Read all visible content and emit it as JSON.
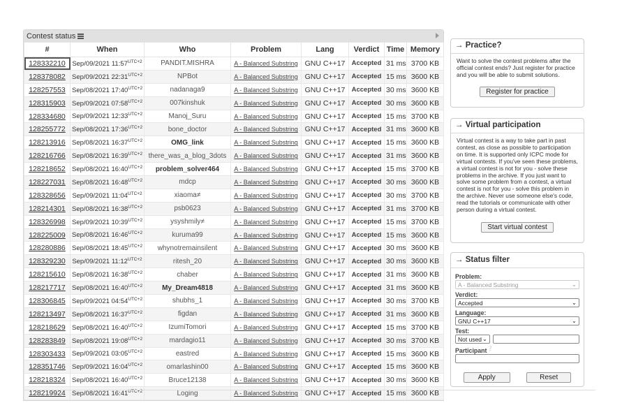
{
  "status": {
    "title": "Contest status",
    "columns": [
      "#",
      "When",
      "Who",
      "Problem",
      "Lang",
      "Verdict",
      "Time",
      "Memory"
    ],
    "rows": [
      {
        "id": "128332210",
        "when": "Sep/09/2021 11:57",
        "tz": "UTC+2",
        "who": "PANDIT.MISHRA",
        "who_bold": false,
        "problem": "A - Balanced Substring",
        "lang": "GNU C++17",
        "verdict": "Accepted",
        "time": "31 ms",
        "memory": "3700 KB"
      },
      {
        "id": "128378082",
        "when": "Sep/09/2021 22:31",
        "tz": "UTC+2",
        "who": "NPBot",
        "who_bold": false,
        "problem": "A - Balanced Substring",
        "lang": "GNU C++17",
        "verdict": "Accepted",
        "time": "15 ms",
        "memory": "3600 KB"
      },
      {
        "id": "128257553",
        "when": "Sep/08/2021 17:40",
        "tz": "UTC+2",
        "who": "nadanaga9",
        "who_bold": false,
        "problem": "A - Balanced Substring",
        "lang": "GNU C++17",
        "verdict": "Accepted",
        "time": "30 ms",
        "memory": "3600 KB"
      },
      {
        "id": "128315903",
        "when": "Sep/09/2021 07:58",
        "tz": "UTC+2",
        "who": "007kinshuk",
        "who_bold": false,
        "problem": "A - Balanced Substring",
        "lang": "GNU C++17",
        "verdict": "Accepted",
        "time": "30 ms",
        "memory": "3600 KB"
      },
      {
        "id": "128334680",
        "when": "Sep/09/2021 12:33",
        "tz": "UTC+2",
        "who": "Manoj_Suru",
        "who_bold": false,
        "problem": "A - Balanced Substring",
        "lang": "GNU C++17",
        "verdict": "Accepted",
        "time": "15 ms",
        "memory": "3700 KB"
      },
      {
        "id": "128255772",
        "when": "Sep/08/2021 17:36",
        "tz": "UTC+2",
        "who": "bone_doctor",
        "who_bold": false,
        "problem": "A - Balanced Substring",
        "lang": "GNU C++17",
        "verdict": "Accepted",
        "time": "31 ms",
        "memory": "3600 KB"
      },
      {
        "id": "128213916",
        "when": "Sep/08/2021 16:37",
        "tz": "UTC+2",
        "who": "OMG_link",
        "who_bold": true,
        "problem": "A - Balanced Substring",
        "lang": "GNU C++17",
        "verdict": "Accepted",
        "time": "15 ms",
        "memory": "3600 KB"
      },
      {
        "id": "128216766",
        "when": "Sep/08/2021 16:39",
        "tz": "UTC+2",
        "who": "there_was_a_blog_3dots",
        "who_bold": false,
        "problem": "A - Balanced Substring",
        "lang": "GNU C++17",
        "verdict": "Accepted",
        "time": "31 ms",
        "memory": "3600 KB"
      },
      {
        "id": "128218652",
        "when": "Sep/08/2021 16:40",
        "tz": "UTC+2",
        "who": "problem_solver464",
        "who_bold": true,
        "problem": "A - Balanced Substring",
        "lang": "GNU C++17",
        "verdict": "Accepted",
        "time": "15 ms",
        "memory": "3700 KB"
      },
      {
        "id": "128227031",
        "when": "Sep/08/2021 16:48",
        "tz": "UTC+2",
        "who": "mdcp",
        "who_bold": false,
        "problem": "A - Balanced Substring",
        "lang": "GNU C++17",
        "verdict": "Accepted",
        "time": "30 ms",
        "memory": "3600 KB"
      },
      {
        "id": "128328656",
        "when": "Sep/09/2021 11:04",
        "tz": "UTC+2",
        "who": "xiaoma≠",
        "who_bold": false,
        "problem": "A - Balanced Substring",
        "lang": "GNU C++17",
        "verdict": "Accepted",
        "time": "30 ms",
        "memory": "3700 KB"
      },
      {
        "id": "128214301",
        "when": "Sep/08/2021 16:38",
        "tz": "UTC+2",
        "who": "psb0623",
        "who_bold": false,
        "problem": "A - Balanced Substring",
        "lang": "GNU C++17",
        "verdict": "Accepted",
        "time": "31 ms",
        "memory": "3700 KB"
      },
      {
        "id": "128326998",
        "when": "Sep/09/2021 10:39",
        "tz": "UTC+2",
        "who": "ysyshmily≠",
        "who_bold": false,
        "problem": "A - Balanced Substring",
        "lang": "GNU C++17",
        "verdict": "Accepted",
        "time": "15 ms",
        "memory": "3700 KB"
      },
      {
        "id": "128225009",
        "when": "Sep/08/2021 16:46",
        "tz": "UTC+2",
        "who": "kuruma99",
        "who_bold": false,
        "problem": "A - Balanced Substring",
        "lang": "GNU C++17",
        "verdict": "Accepted",
        "time": "15 ms",
        "memory": "3600 KB"
      },
      {
        "id": "128280886",
        "when": "Sep/08/2021 18:45",
        "tz": "UTC+2",
        "who": "whynotremainsilent",
        "who_bold": false,
        "problem": "A - Balanced Substring",
        "lang": "GNU C++17",
        "verdict": "Accepted",
        "time": "30 ms",
        "memory": "3600 KB"
      },
      {
        "id": "128329230",
        "when": "Sep/09/2021 11:12",
        "tz": "UTC+2",
        "who": "ritesh_20",
        "who_bold": false,
        "problem": "A - Balanced Substring",
        "lang": "GNU C++17",
        "verdict": "Accepted",
        "time": "30 ms",
        "memory": "3600 KB"
      },
      {
        "id": "128215610",
        "when": "Sep/08/2021 16:38",
        "tz": "UTC+2",
        "who": "chaber",
        "who_bold": false,
        "problem": "A - Balanced Substring",
        "lang": "GNU C++17",
        "verdict": "Accepted",
        "time": "31 ms",
        "memory": "3600 KB"
      },
      {
        "id": "128217717",
        "when": "Sep/08/2021 16:40",
        "tz": "UTC+2",
        "who": "My_Dream4818",
        "who_bold": true,
        "problem": "A - Balanced Substring",
        "lang": "GNU C++17",
        "verdict": "Accepted",
        "time": "31 ms",
        "memory": "3600 KB"
      },
      {
        "id": "128306845",
        "when": "Sep/09/2021 04:54",
        "tz": "UTC+2",
        "who": "shubhs_1",
        "who_bold": false,
        "problem": "A - Balanced Substring",
        "lang": "GNU C++17",
        "verdict": "Accepted",
        "time": "30 ms",
        "memory": "3700 KB"
      },
      {
        "id": "128213497",
        "when": "Sep/08/2021 16:37",
        "tz": "UTC+2",
        "who": "figdan",
        "who_bold": false,
        "problem": "A - Balanced Substring",
        "lang": "GNU C++17",
        "verdict": "Accepted",
        "time": "31 ms",
        "memory": "3600 KB"
      },
      {
        "id": "128218629",
        "when": "Sep/08/2021 16:40",
        "tz": "UTC+2",
        "who": "IzumiTomori",
        "who_bold": false,
        "problem": "A - Balanced Substring",
        "lang": "GNU C++17",
        "verdict": "Accepted",
        "time": "15 ms",
        "memory": "3700 KB"
      },
      {
        "id": "128283849",
        "when": "Sep/08/2021 19:08",
        "tz": "UTC+2",
        "who": "mardagio11",
        "who_bold": false,
        "problem": "A - Balanced Substring",
        "lang": "GNU C++17",
        "verdict": "Accepted",
        "time": "30 ms",
        "memory": "3700 KB"
      },
      {
        "id": "128303433",
        "when": "Sep/09/2021 03:05",
        "tz": "UTC+2",
        "who": "eastred",
        "who_bold": false,
        "problem": "A - Balanced Substring",
        "lang": "GNU C++17",
        "verdict": "Accepted",
        "time": "15 ms",
        "memory": "3600 KB"
      },
      {
        "id": "128351746",
        "when": "Sep/09/2021 16:04",
        "tz": "UTC+2",
        "who": "omarlashin00",
        "who_bold": false,
        "problem": "A - Balanced Substring",
        "lang": "GNU C++17",
        "verdict": "Accepted",
        "time": "15 ms",
        "memory": "3600 KB"
      },
      {
        "id": "128218324",
        "when": "Sep/08/2021 16:40",
        "tz": "UTC+2",
        "who": "Bruce12138",
        "who_bold": false,
        "problem": "A - Balanced Substring",
        "lang": "GNU C++17",
        "verdict": "Accepted",
        "time": "30 ms",
        "memory": "3600 KB"
      },
      {
        "id": "128219924",
        "when": "Sep/08/2021 16:41",
        "tz": "UTC+2",
        "who": "Loging",
        "who_bold": false,
        "problem": "A - Balanced Substring",
        "lang": "GNU C++17",
        "verdict": "Accepted",
        "time": "15 ms",
        "memory": "3600 KB"
      }
    ]
  },
  "practice": {
    "title": "→ Practice?",
    "text": "Want to solve the contest problems after the official contest ends? Just register for practice and you will be able to submit solutions.",
    "button": "Register for practice"
  },
  "virtual": {
    "title": "→ Virtual participation",
    "text": "Virtual contest is a way to take part in past contest, as close as possible to participation on time. It is supported only ICPC mode for virtual contests. If you've seen these problems, a virtual contest is not for you - solve these problems in the archive. If you just want to solve some problem from a contest, a virtual contest is not for you - solve this problem in the archive. Never use someone else's code, read the tutorials or communicate with other person during a virtual contest.",
    "button": "Start virtual contest"
  },
  "filter": {
    "title": "→ Status filter",
    "problem_label": "Problem:",
    "problem_value": "A - Balanced Substring",
    "verdict_label": "Verdict:",
    "verdict_value": "Accepted",
    "language_label": "Language:",
    "language_value": "GNU C++17",
    "test_label": "Test:",
    "test_value": "Not used",
    "participant_label": "Participant",
    "apply": "Apply",
    "reset": "Reset"
  }
}
